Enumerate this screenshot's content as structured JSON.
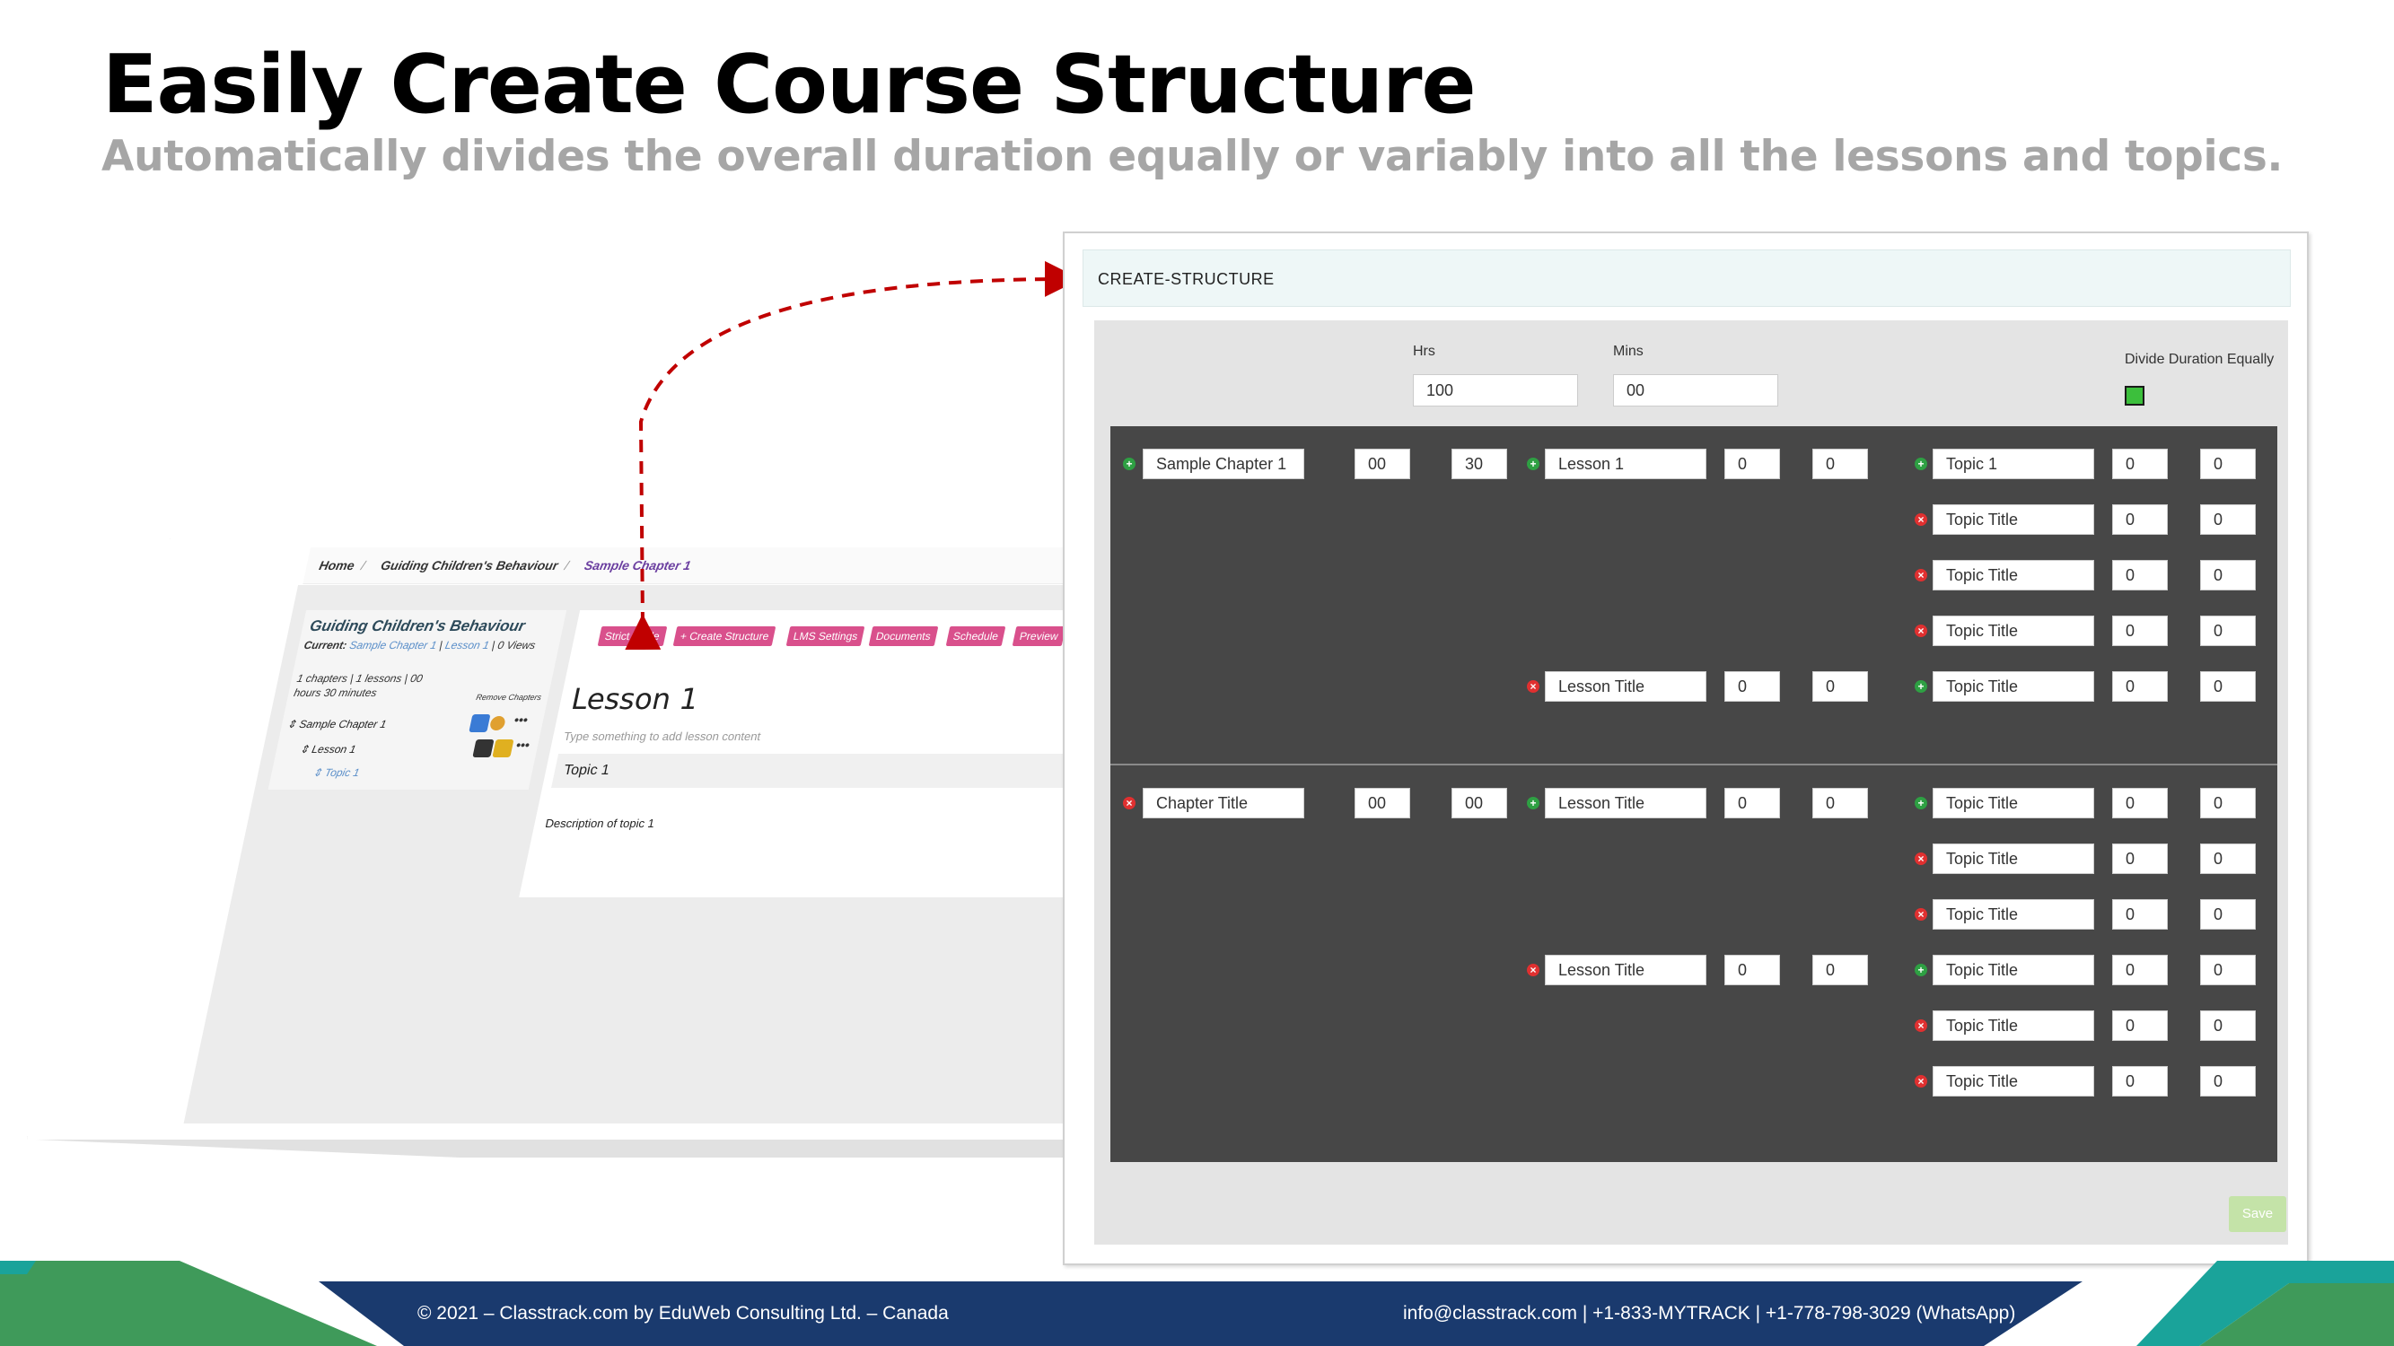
{
  "slide": {
    "title": "Easily Create Course Structure",
    "subtitle": "Automatically divides the overall duration equally or variably into all the lessons and topics."
  },
  "background_screenshot": {
    "breadcrumb": [
      "Home",
      "Guiding Children's Behaviour",
      "Sample Chapter 1"
    ],
    "course_name": "Guiding Children's Behaviour",
    "current_label": "Current:",
    "current_chapter": "Sample Chapter 1",
    "current_lesson": "Lesson 1",
    "views": "| 0 Views",
    "summary": "1 chapters | 1 lessons | 00 hours 30 minutes",
    "remove_chapters": "Remove Chapters",
    "tree": {
      "chapter": "Sample Chapter 1",
      "lesson": "Lesson 1",
      "topic": "Topic 1"
    },
    "buttons": [
      "Strict Mode",
      "+ Create Structure",
      "LMS Settings",
      "Documents",
      "Schedule",
      "Preview"
    ],
    "lesson_heading": "Lesson 1",
    "lesson_placeholder": "Type something to add lesson content",
    "topic_bar": "Topic 1",
    "topic_description": "Description of topic 1",
    "colors": {
      "button_pink": "#d9508c",
      "course_title": "#2d4a5a"
    }
  },
  "create_structure": {
    "header": "CREATE-STRUCTURE",
    "hrs_label": "Hrs",
    "hrs_value": "100",
    "mins_label": "Mins",
    "mins_value": "00",
    "divide_label": "Divide Duration Equally",
    "divide_checked": true,
    "save_label": "Save",
    "chapters": [
      {
        "title": "Sample Chapter 1",
        "hrs": "00",
        "mins": "30",
        "lessons": [
          {
            "title": "Lesson 1",
            "hrs": "0",
            "mins": "0",
            "topics": [
              {
                "title": "Topic 1",
                "hrs": "0",
                "mins": "0"
              },
              {
                "title": "Topic Title",
                "hrs": "0",
                "mins": "0"
              },
              {
                "title": "Topic Title",
                "hrs": "0",
                "mins": "0"
              },
              {
                "title": "Topic Title",
                "hrs": "0",
                "mins": "0"
              }
            ]
          },
          {
            "title": "Lesson Title",
            "hrs": "0",
            "mins": "0",
            "topics": [
              {
                "title": "Topic Title",
                "hrs": "0",
                "mins": "0"
              }
            ]
          }
        ]
      },
      {
        "title": "Chapter Title",
        "hrs": "00",
        "mins": "00",
        "lessons": [
          {
            "title": "Lesson Title",
            "hrs": "0",
            "mins": "0",
            "topics": [
              {
                "title": "Topic Title",
                "hrs": "0",
                "mins": "0"
              },
              {
                "title": "Topic Title",
                "hrs": "0",
                "mins": "0"
              },
              {
                "title": "Topic Title",
                "hrs": "0",
                "mins": "0"
              }
            ]
          },
          {
            "title": "Lesson Title",
            "hrs": "0",
            "mins": "0",
            "topics": [
              {
                "title": "Topic Title",
                "hrs": "0",
                "mins": "0"
              },
              {
                "title": "Topic Title",
                "hrs": "0",
                "mins": "0"
              },
              {
                "title": "Topic Title",
                "hrs": "0",
                "mins": "0"
              }
            ]
          }
        ]
      }
    ],
    "colors": {
      "grid_bg": "#474747",
      "add": "#2ea043",
      "remove": "#e03030",
      "check": "#3cbf3c",
      "save": "#c4e3a8"
    }
  },
  "footer": {
    "left": "© 2021 – Classtrack.com by EduWeb Consulting Ltd. – Canada",
    "right": "info@classtrack.com | +1-833-MYTRACK | +1-778-798-3029 (WhatsApp)",
    "colors": {
      "green": "#3f9a5a",
      "teal": "#1aa39a",
      "navy": "#1a3a6e"
    }
  }
}
